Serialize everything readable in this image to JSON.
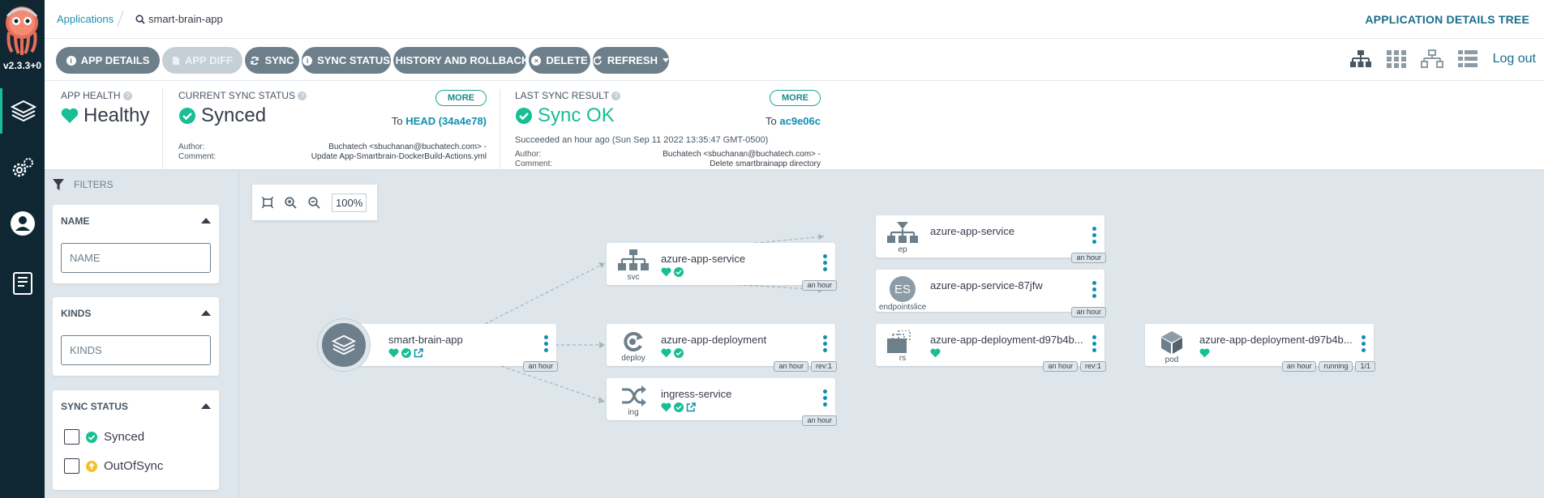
{
  "nav": {
    "version": "v2.3.3+0"
  },
  "breadcrumb": {
    "applications": "Applications",
    "app": "smart-brain-app"
  },
  "header": {
    "view_title": "APPLICATION DETAILS TREE",
    "logout": "Log out"
  },
  "toolbar": {
    "app_details": "APP DETAILS",
    "app_diff": "APP DIFF",
    "sync": "SYNC",
    "sync_status": "SYNC STATUS",
    "history": "HISTORY AND ROLLBACK",
    "delete": "DELETE",
    "refresh": "REFRESH"
  },
  "status": {
    "health_label": "APP HEALTH",
    "health_value": "Healthy",
    "sync_label": "CURRENT SYNC STATUS",
    "sync_value": "Synced",
    "sync_more": "MORE",
    "sync_to_prefix": "To",
    "sync_to_rev": "HEAD (34a4e78)",
    "sync_author_label": "Author:",
    "sync_author": "Buchatech <sbuchanan@buchatech.com> -",
    "sync_comment_label": "Comment:",
    "sync_comment": "Update App-Smartbrain-DockerBuild-Actions.yml",
    "last_label": "LAST SYNC RESULT",
    "last_value": "Sync OK",
    "last_more": "MORE",
    "last_to_prefix": "To",
    "last_to_rev": "ac9e06c",
    "last_succeeded": "Succeeded an hour ago (Sun Sep 11 2022 13:35:47 GMT-0500)",
    "last_author_label": "Author:",
    "last_author": "Buchatech <sbuchanan@buchatech.com> -",
    "last_comment_label": "Comment:",
    "last_comment": "Delete smartbrainapp directory"
  },
  "filters": {
    "title": "FILTERS",
    "name_title": "NAME",
    "name_placeholder": "NAME",
    "kinds_title": "KINDS",
    "kinds_placeholder": "KINDS",
    "sync_status_title": "SYNC STATUS",
    "synced": "Synced",
    "out_of_sync": "OutOfSync"
  },
  "zoom": {
    "level": "100%"
  },
  "colors": {
    "accent": "#18be94",
    "link": "#0f8fb0",
    "button": "#6d7f8b",
    "nav": "#0f2733"
  },
  "nodes": {
    "app": {
      "name": "smart-brain-app",
      "age": "an hour"
    },
    "svc": {
      "name": "azure-app-service",
      "kind": "svc",
      "age": "an hour"
    },
    "deploy": {
      "name": "azure-app-deployment",
      "kind": "deploy",
      "age": "an hour",
      "rev": "rev:1"
    },
    "ing": {
      "name": "ingress-service",
      "kind": "ing",
      "age": "an hour"
    },
    "ep": {
      "name": "azure-app-service",
      "kind": "ep",
      "age": "an hour"
    },
    "es": {
      "name": "azure-app-service-87jfw",
      "kind": "endpointslice",
      "badge": "ES",
      "age": "an hour"
    },
    "rs": {
      "name": "azure-app-deployment-d97b4b...",
      "kind": "rs",
      "age": "an hour",
      "rev": "rev:1"
    },
    "pod": {
      "name": "azure-app-deployment-d97b4b...",
      "kind": "pod",
      "age": "an hour",
      "state": "running",
      "ready": "1/1"
    }
  }
}
